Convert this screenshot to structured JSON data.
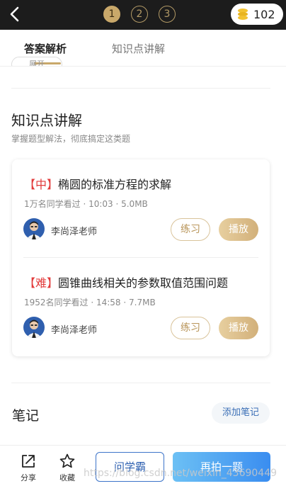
{
  "header": {
    "steps": [
      "1",
      "2",
      "3"
    ],
    "active_step": "1",
    "coins": "102",
    "icons": {
      "back": "back-arrow-icon",
      "coin": "coin-stack-icon"
    }
  },
  "tabs": [
    {
      "label": "答案解析",
      "active": true
    },
    {
      "label": "知识点讲解",
      "active": false
    }
  ],
  "clipped_pill": "展开",
  "knowledge": {
    "title": "知识点讲解",
    "subtitle": "掌握题型解法，彻底搞定这类题",
    "lessons": [
      {
        "level": "【中】",
        "title": "椭圆的标准方程的求解",
        "meta": "1万名同学看过 · 10:03 · 5.0MB",
        "teacher": "李尚泽老师",
        "practice_label": "练习",
        "play_label": "播放"
      },
      {
        "level": "【难】",
        "title": "圆锥曲线相关的参数取值范围问题",
        "meta": "1952名同学看过 · 14:58 · 7.7MB",
        "teacher": "李尚泽老师",
        "practice_label": "练习",
        "play_label": "播放"
      }
    ]
  },
  "notes": {
    "title": "笔记",
    "add_label": "添加笔记"
  },
  "bottom": {
    "share_label": "分享",
    "favorite_label": "收藏",
    "ask_label": "问学霸",
    "retake_label": "再拍一题"
  },
  "watermark": "https://blog.csdn.net/weixin_43690449",
  "colors": {
    "accent_gold": "#c9a86a",
    "level_red": "#e23b3b",
    "link_blue": "#3b6fb6",
    "topbar": "#1c1c1c"
  }
}
